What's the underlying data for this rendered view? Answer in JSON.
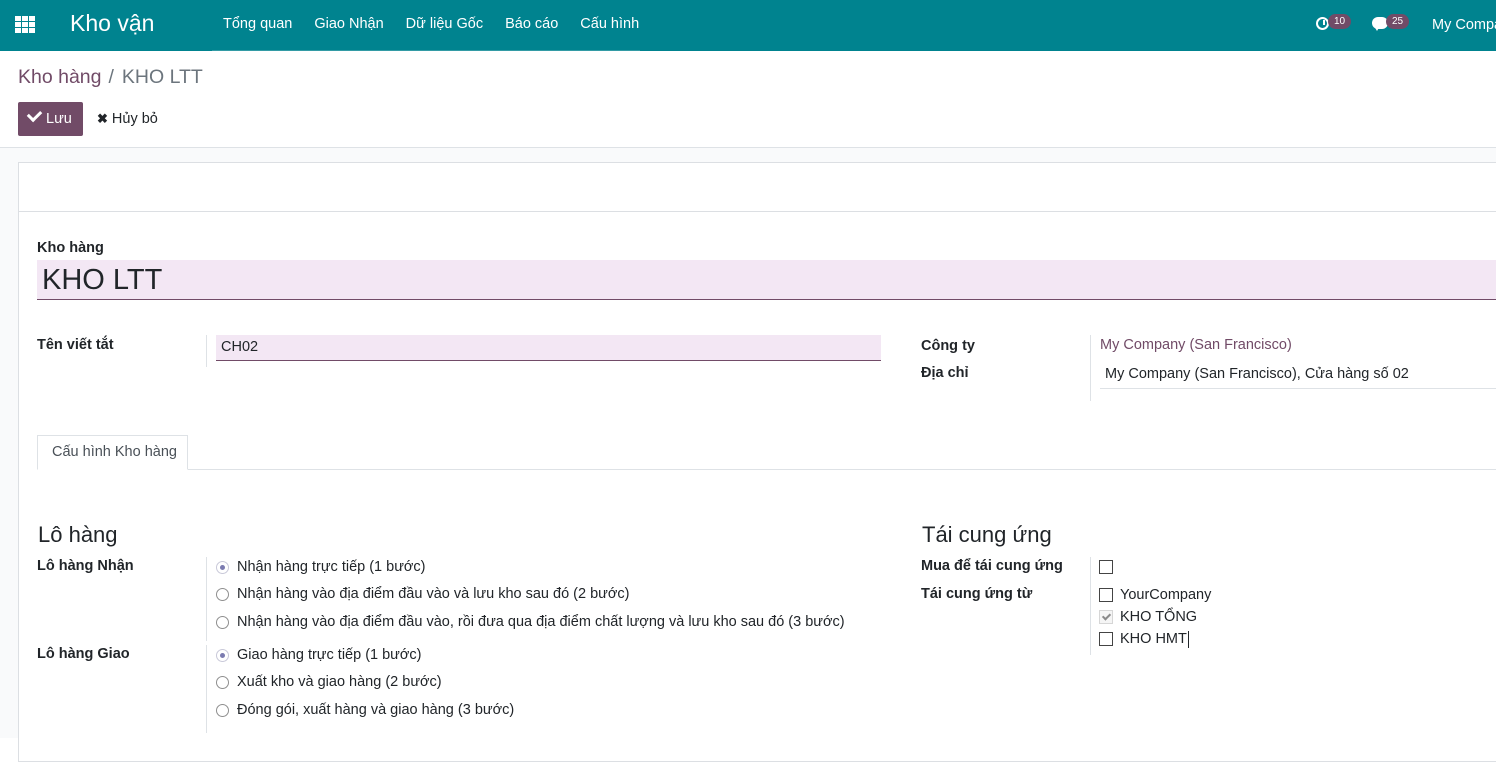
{
  "navbar": {
    "app_title": "Kho vận",
    "menu": [
      "Tổng quan",
      "Giao Nhận",
      "Dữ liệu Gốc",
      "Báo cáo",
      "Cấu hình"
    ],
    "activity_count": "10",
    "message_count": "25",
    "company": "My Compa"
  },
  "breadcrumb": {
    "parent": "Kho hàng",
    "separator": "/",
    "current": "KHO LTT"
  },
  "toolbar": {
    "save_label": "Lưu",
    "discard_label": "Hủy bỏ"
  },
  "form": {
    "name_label": "Kho hàng",
    "name_value": "KHO LTT",
    "code_label": "Tên viết tắt",
    "code_value": "CH02",
    "company_label": "Công ty",
    "company_value": "My Company (San Francisco)",
    "address_label": "Địa chỉ",
    "address_value": "My Company (San Francisco), Cửa hàng số 02"
  },
  "tabs": [
    {
      "label": "Cấu hình Kho hàng",
      "active": true
    }
  ],
  "shipments": {
    "title": "Lô hàng",
    "incoming_label": "Lô hàng Nhận",
    "incoming_options": [
      {
        "label": "Nhận hàng trực tiếp (1 bước)",
        "selected": true
      },
      {
        "label": "Nhận hàng vào địa điểm đầu vào và lưu kho sau đó (2 bước)",
        "selected": false
      },
      {
        "label": "Nhận hàng vào địa điểm đầu vào, rồi đưa qua địa điểm chất lượng và lưu kho sau đó (3 bước)",
        "selected": false
      }
    ],
    "outgoing_label": "Lô hàng Giao",
    "outgoing_options": [
      {
        "label": "Giao hàng trực tiếp (1 bước)",
        "selected": true
      },
      {
        "label": "Xuất kho và giao hàng (2 bước)",
        "selected": false
      },
      {
        "label": "Đóng gói, xuất hàng và giao hàng (3 bước)",
        "selected": false
      }
    ]
  },
  "resupply": {
    "title": "Tái cung ứng",
    "buy_label": "Mua để tái cung ứng",
    "buy_checked": false,
    "from_label": "Tái cung ứng từ",
    "from_options": [
      {
        "label": "YourCompany",
        "checked": false
      },
      {
        "label": "KHO TỔNG",
        "checked": true
      },
      {
        "label": "KHO HMT",
        "checked": false
      }
    ]
  },
  "colors": {
    "navbar": "#00838f",
    "primary": "#714b67",
    "field_bg": "#f3e7f4"
  }
}
